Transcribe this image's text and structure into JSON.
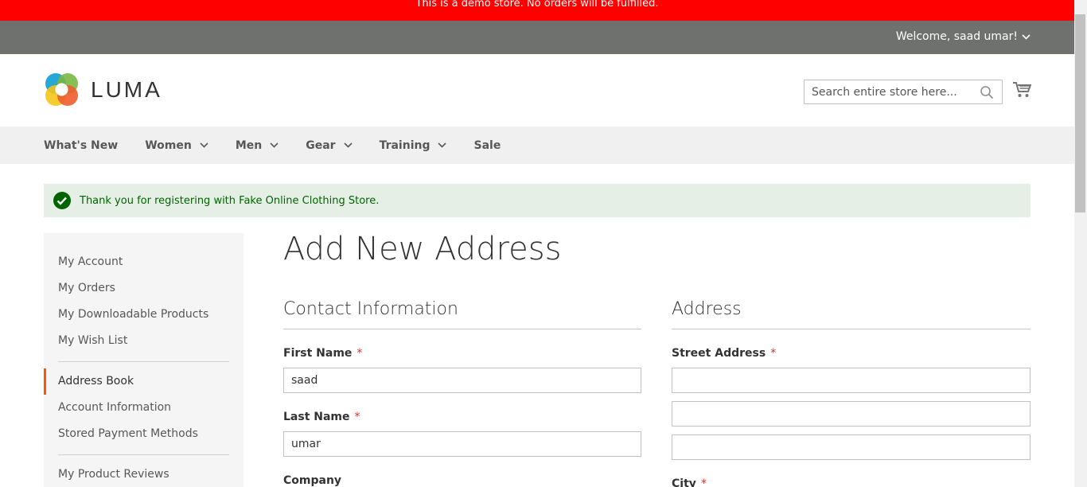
{
  "demo_notice": "This is a demo store. No orders will be fulfilled.",
  "top_bar": {
    "welcome": "Welcome, saad umar!"
  },
  "header": {
    "logo_text": "LUMA",
    "search_placeholder": "Search entire store here..."
  },
  "nav": {
    "items": [
      {
        "label": "What's New",
        "has_dropdown": false
      },
      {
        "label": "Women",
        "has_dropdown": true
      },
      {
        "label": "Men",
        "has_dropdown": true
      },
      {
        "label": "Gear",
        "has_dropdown": true
      },
      {
        "label": "Training",
        "has_dropdown": true
      },
      {
        "label": "Sale",
        "has_dropdown": false
      }
    ]
  },
  "message": {
    "text": "Thank you for registering with Fake Online Clothing Store."
  },
  "sidebar": {
    "group1": [
      "My Account",
      "My Orders",
      "My Downloadable Products",
      "My Wish List"
    ],
    "group2": [
      "Address Book",
      "Account Information",
      "Stored Payment Methods"
    ],
    "group3": [
      "My Product Reviews"
    ],
    "active": "Address Book"
  },
  "page": {
    "title": "Add New Address"
  },
  "contact": {
    "legend": "Contact Information",
    "first_name_label": "First Name",
    "first_name_value": "saad",
    "last_name_label": "Last Name",
    "last_name_value": "umar",
    "company_label": "Company",
    "required_mark": "*"
  },
  "address": {
    "legend": "Address",
    "street_label": "Street Address",
    "city_label": "City"
  },
  "colors": {
    "demo_bar": "#ff0000",
    "top_bar": "#6e716e",
    "nav_bg": "#f0f0f0",
    "success_bg": "#e5efe5",
    "success_text": "#006400",
    "active_accent": "#ff5501",
    "required": "#e02b27"
  }
}
